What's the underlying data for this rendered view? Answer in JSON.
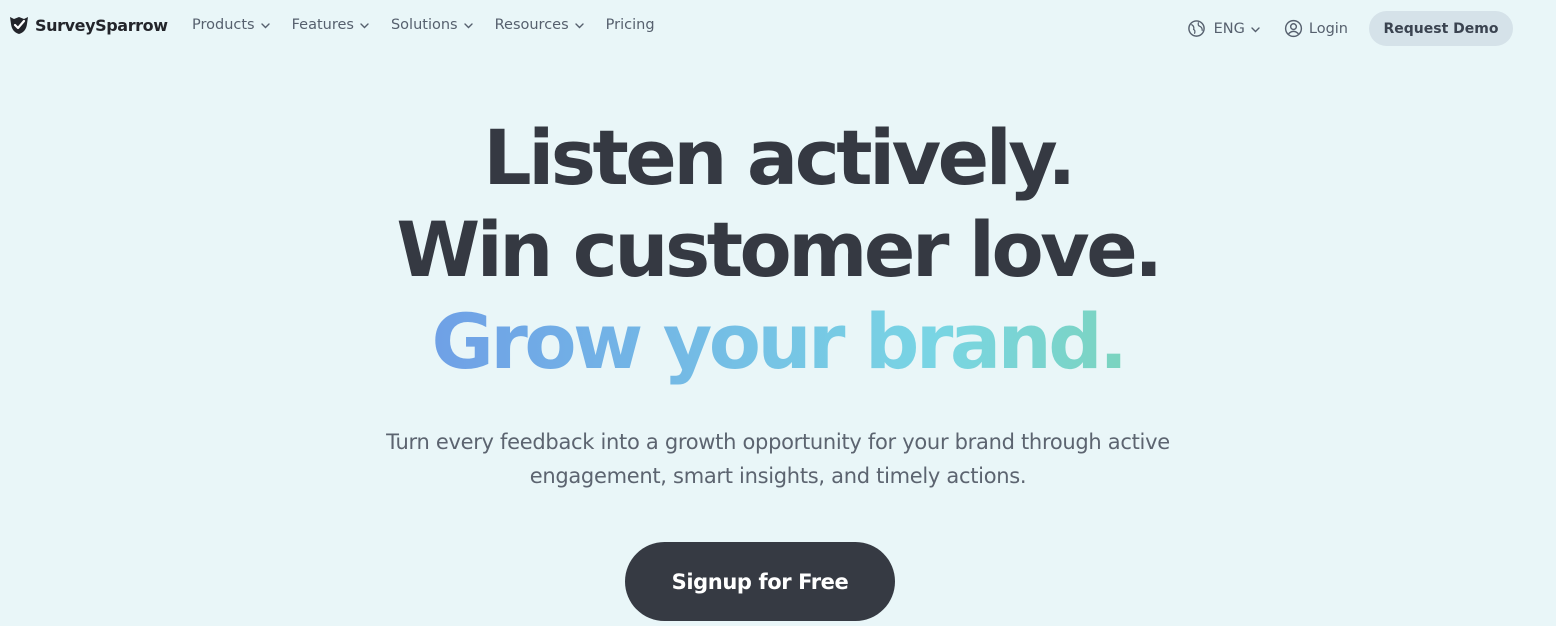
{
  "nav": {
    "brand": "SurveySparrow",
    "items": [
      {
        "label": "Products",
        "has_dropdown": true
      },
      {
        "label": "Features",
        "has_dropdown": true
      },
      {
        "label": "Solutions",
        "has_dropdown": true
      },
      {
        "label": "Resources",
        "has_dropdown": true
      },
      {
        "label": "Pricing",
        "has_dropdown": false
      }
    ],
    "language": "ENG",
    "login": "Login",
    "request_demo": "Request Demo"
  },
  "hero": {
    "line1": "Listen actively.",
    "line2": "Win customer love.",
    "line3": "Grow your brand.",
    "subtitle": "Turn every feedback into a growth opportunity for your brand through active engagement, smart insights, and timely actions.",
    "cta": "Signup for Free"
  },
  "colors": {
    "background": "#e9f6f8",
    "text_dark": "#353942",
    "gradient": [
      "#6a78e8",
      "#70a8e6",
      "#79d5e4",
      "#7dd3a2",
      "#7ecb6a"
    ],
    "cta_background": "#363a43",
    "demo_button_background": "#d5e2e9"
  },
  "icons": {
    "logo": "sparrow-logo-icon",
    "language": "globe-icon",
    "login": "user-circle-icon",
    "dropdown": "chevron-down-icon"
  }
}
